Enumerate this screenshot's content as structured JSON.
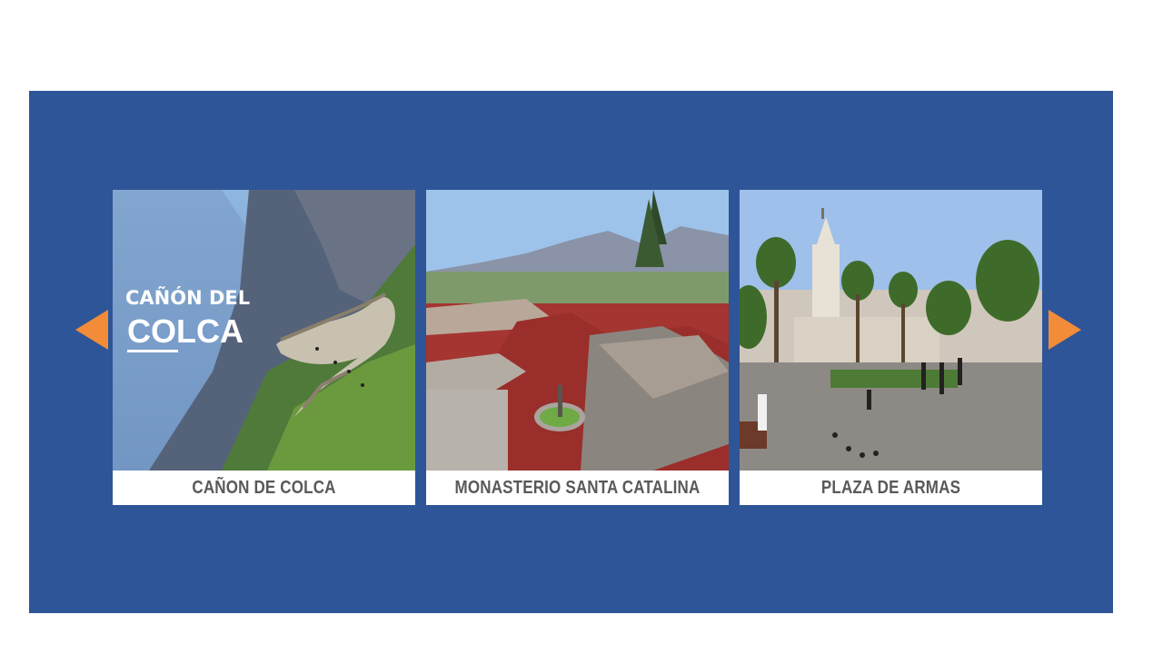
{
  "carousel": {
    "prev_icon": "caret-left-icon",
    "next_icon": "caret-right-icon",
    "accent_color": "#f28c38",
    "panel_color": "#2e5597",
    "cards": [
      {
        "caption": "CAÑON DE COLCA",
        "overlay_line1": "CAÑÓN DEL",
        "overlay_line2": "COLCA"
      },
      {
        "caption": "MONASTERIO SANTA CATALINA"
      },
      {
        "caption": "PLAZA DE ARMAS"
      }
    ]
  }
}
